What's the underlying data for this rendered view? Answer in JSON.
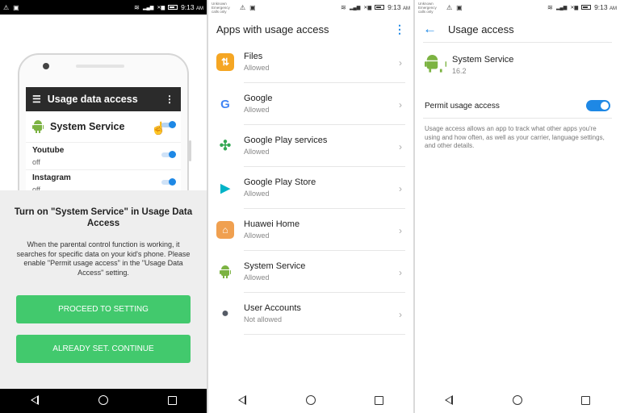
{
  "status": {
    "time": "9:13",
    "ampm": "AM",
    "carrier_line1": "Unknown",
    "carrier_line2": "Emergency calls only"
  },
  "panel1": {
    "mock": {
      "title": "Usage data access",
      "app_name": "System Service",
      "rows": [
        {
          "name": "Youtube",
          "state": "off"
        },
        {
          "name": "Instagram",
          "state": "off"
        }
      ]
    },
    "sheet": {
      "title": "Turn on \"System Service\" in Usage Data Access",
      "text": "When the parental control function is working, it searches for specific data on your kid's phone. Please enable \"Permit usage access\" in the \"Usage Data Access\" setting.",
      "proceed_label": "PROCEED TO SETTING",
      "already_label": "ALREADY SET. CONTINUE"
    }
  },
  "panel2": {
    "title": "Apps with usage access",
    "apps": [
      {
        "name": "Files",
        "status": "Allowed",
        "icon": "files-icon",
        "color": "#f5a623"
      },
      {
        "name": "Google",
        "status": "Allowed",
        "icon": "google-icon",
        "color": "#4285f4"
      },
      {
        "name": "Google Play services",
        "status": "Allowed",
        "icon": "play-services-icon",
        "color": "#34a853"
      },
      {
        "name": "Google Play Store",
        "status": "Allowed",
        "icon": "play-store-icon",
        "color": "#00c1d4"
      },
      {
        "name": "Huawei Home",
        "status": "Allowed",
        "icon": "huawei-home-icon",
        "color": "#f0a050"
      },
      {
        "name": "System Service",
        "status": "Allowed",
        "icon": "android-icon",
        "color": "#7cb342"
      },
      {
        "name": "User Accounts",
        "status": "Not allowed",
        "icon": "user-icon",
        "color": "#555b66"
      }
    ]
  },
  "panel3": {
    "title": "Usage access",
    "app_name": "System Service",
    "version": "16.2",
    "permit_label": "Permit usage access",
    "permit_on": true,
    "description": "Usage access allows an app to track what other apps you're using and how often, as well as your carrier, language settings, and other details."
  },
  "colors": {
    "accent": "#1e88e5",
    "green_button": "#42c96d",
    "android_green": "#7cb342"
  }
}
